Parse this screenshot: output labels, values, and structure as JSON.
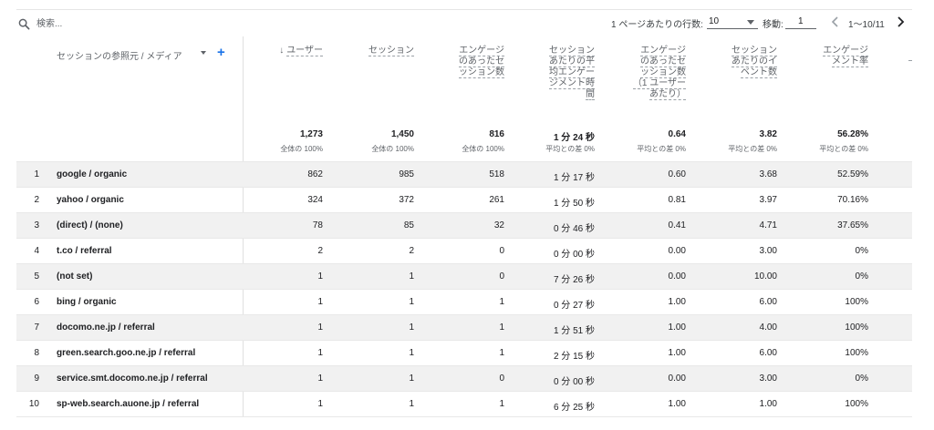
{
  "toolbar": {
    "search_placeholder": "検索...",
    "rows_per_page_label": "1 ページあたりの行数:",
    "rows_per_page_value": "10",
    "goto_label": "移動:",
    "goto_value": "1",
    "page_range": "1〜10/11"
  },
  "table": {
    "dimension_header": "セッションの参照元 / メディア",
    "sort_arrow": "↓",
    "columns": [
      {
        "key": "users",
        "lines": [
          "ユーザー"
        ],
        "sorted": true,
        "total": "1,273",
        "sub": "全体の 100%"
      },
      {
        "key": "sessions",
        "lines": [
          "セッション"
        ],
        "sorted": false,
        "total": "1,450",
        "sub": "全体の 100%"
      },
      {
        "key": "engaged_sessions",
        "lines": [
          "エンゲージ",
          "のあったセ",
          "ッション数"
        ],
        "sorted": false,
        "total": "816",
        "sub": "全体の 100%"
      },
      {
        "key": "avg_engagement_time",
        "lines": [
          "セッション",
          "あたりの平",
          "均エンゲー",
          "ジメント時",
          "間"
        ],
        "sorted": false,
        "total": "1 分 24 秒",
        "sub": "平均との差 0%"
      },
      {
        "key": "engaged_per_user",
        "lines": [
          "エンゲージ",
          "のあったセ",
          "ッション数",
          "（1 ユーザー",
          "あたり）"
        ],
        "sorted": false,
        "total": "0.64",
        "sub": "平均との差 0%"
      },
      {
        "key": "events_per_session",
        "lines": [
          "セッション",
          "あたりのイ",
          "ベント数"
        ],
        "sorted": false,
        "total": "3.82",
        "sub": "平均との差 0%"
      },
      {
        "key": "engagement_rate",
        "lines": [
          "エンゲージ",
          "メント率"
        ],
        "sorted": false,
        "total": "56.28%",
        "sub": "平均との差 0%"
      }
    ],
    "rows": [
      {
        "idx": "1",
        "dim": "google / organic",
        "cells": [
          "862",
          "985",
          "518",
          "1 分 17 秒",
          "0.60",
          "3.68",
          "52.59%"
        ]
      },
      {
        "idx": "2",
        "dim": "yahoo / organic",
        "cells": [
          "324",
          "372",
          "261",
          "1 分 50 秒",
          "0.81",
          "3.97",
          "70.16%"
        ]
      },
      {
        "idx": "3",
        "dim": "(direct) / (none)",
        "cells": [
          "78",
          "85",
          "32",
          "0 分 46 秒",
          "0.41",
          "4.71",
          "37.65%"
        ]
      },
      {
        "idx": "4",
        "dim": "t.co / referral",
        "cells": [
          "2",
          "2",
          "0",
          "0 分 00 秒",
          "0.00",
          "3.00",
          "0%"
        ]
      },
      {
        "idx": "5",
        "dim": "(not set)",
        "cells": [
          "1",
          "1",
          "0",
          "7 分 26 秒",
          "0.00",
          "10.00",
          "0%"
        ]
      },
      {
        "idx": "6",
        "dim": "bing / organic",
        "cells": [
          "1",
          "1",
          "1",
          "0 分 27 秒",
          "1.00",
          "6.00",
          "100%"
        ]
      },
      {
        "idx": "7",
        "dim": "docomo.ne.jp / referral",
        "cells": [
          "1",
          "1",
          "1",
          "1 分 51 秒",
          "1.00",
          "4.00",
          "100%"
        ]
      },
      {
        "idx": "8",
        "dim": "green.search.goo.ne.jp / referral",
        "cells": [
          "1",
          "1",
          "1",
          "2 分 15 秒",
          "1.00",
          "6.00",
          "100%"
        ]
      },
      {
        "idx": "9",
        "dim": "service.smt.docomo.ne.jp / referral",
        "cells": [
          "1",
          "1",
          "0",
          "0 分 00 秒",
          "0.00",
          "3.00",
          "0%"
        ]
      },
      {
        "idx": "10",
        "dim": "sp-web.search.auone.jp / referral",
        "cells": [
          "1",
          "1",
          "1",
          "6 分 25 秒",
          "1.00",
          "1.00",
          "100%"
        ]
      }
    ]
  },
  "colors": {
    "accent": "#1a73e8",
    "row_shade": "#f1f1f1",
    "text": "#202124",
    "muted": "#5f6368"
  }
}
